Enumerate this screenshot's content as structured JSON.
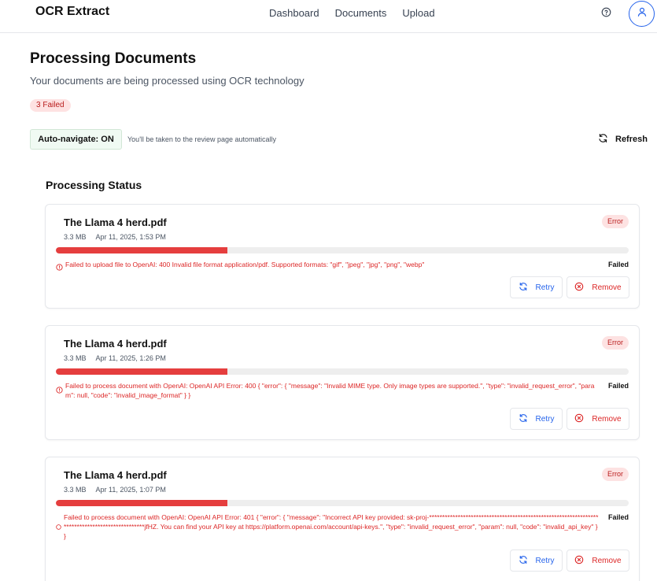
{
  "header": {
    "brand": "OCR Extract",
    "nav": [
      "Dashboard",
      "Documents",
      "Upload"
    ]
  },
  "page": {
    "title": "Processing Documents",
    "subtitle": "Your documents are being processed using OCR technology",
    "failed_badge": "3 Failed",
    "autonav_label": "Auto-navigate: ON",
    "autonav_note": "You'll be taken to the review page automatically",
    "refresh_label": "Refresh",
    "section_title": "Processing Status"
  },
  "colors": {
    "accent": "#2563eb",
    "error": "#dc2626",
    "progress_fill": "#e53e3e",
    "autonav_bg": "#f0faf3"
  },
  "icons": [
    "help-icon",
    "user-icon",
    "refresh-icon",
    "alert-circle-icon",
    "retry-icon",
    "remove-x-circle-icon"
  ],
  "documents": [
    {
      "name": "The Llama 4 herd.pdf",
      "size": "3.3 MB",
      "date": "Apr 11, 2025, 1:53 PM",
      "badge": "Error",
      "progress": 0.3,
      "status": "Failed",
      "error": "Failed to upload file to OpenAI: 400 Invalid file format application/pdf. Supported formats: \"gif\", \"jpeg\", \"jpg\", \"png\", \"webp\"",
      "retry_label": "Retry",
      "remove_label": "Remove"
    },
    {
      "name": "The Llama 4 herd.pdf",
      "size": "3.3 MB",
      "date": "Apr 11, 2025, 1:26 PM",
      "badge": "Error",
      "progress": 0.3,
      "status": "Failed",
      "error": "Failed to process document with OpenAI: OpenAI API Error: 400 { \"error\": { \"message\": \"Invalid MIME type. Only image types are supported.\", \"type\": \"invalid_request_error\", \"param\": null, \"code\": \"invalid_image_format\" } }",
      "retry_label": "Retry",
      "remove_label": "Remove"
    },
    {
      "name": "The Llama 4 herd.pdf",
      "size": "3.3 MB",
      "date": "Apr 11, 2025, 1:07 PM",
      "badge": "Error",
      "progress": 0.3,
      "status": "Failed",
      "error": "Failed to process document with OpenAI: OpenAI API Error: 401 { \"error\": { \"message\": \"Incorrect API key provided: sk-proj-************************************************************************************************jfHZ. You can find your API key at https://platform.openai.com/account/api-keys.\", \"type\": \"invalid_request_error\", \"param\": null, \"code\": \"invalid_api_key\" } }",
      "retry_label": "Retry",
      "remove_label": "Remove"
    }
  ]
}
